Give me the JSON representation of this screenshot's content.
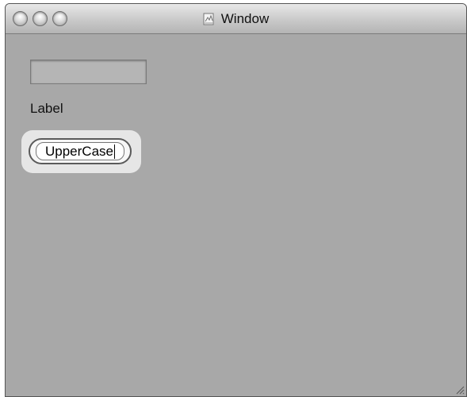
{
  "window": {
    "title": "Window",
    "title_icon": "document-icon"
  },
  "titlebar_buttons": [
    {
      "name": "close",
      "icon": "close-icon"
    },
    {
      "name": "minimize",
      "icon": "minimize-icon"
    },
    {
      "name": "zoom",
      "icon": "zoom-icon"
    }
  ],
  "form": {
    "text_field_value": "",
    "label_text": "Label",
    "rounded_field_value": "UpperCase"
  },
  "colors": {
    "window_background": "#a8a8a8",
    "focus_halo": "#e6e6e6"
  }
}
